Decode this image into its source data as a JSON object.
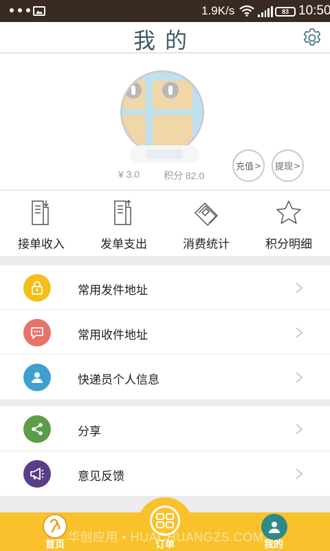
{
  "status_bar": {
    "net_speed": "1.9K/s",
    "battery": "83",
    "time": "10:50"
  },
  "header": {
    "title": "我的",
    "settings_icon": "gear-icon"
  },
  "profile": {
    "balance": "¥ 3.0",
    "points": "积分 82.0",
    "recharge_label": "充值",
    "withdraw_label": "提现"
  },
  "quick_actions": [
    {
      "label": "接单收入",
      "icon": "receive-order-doc-icon"
    },
    {
      "label": "发单支出",
      "icon": "send-order-doc-icon"
    },
    {
      "label": "消费统计",
      "icon": "ticket-stats-icon"
    },
    {
      "label": "积分明细",
      "icon": "star-icon"
    }
  ],
  "menu_group_1": [
    {
      "label": "常用发件地址",
      "icon": "lock-icon",
      "color": "#f5bf1a"
    },
    {
      "label": "常用收件地址",
      "icon": "chat-bubble-icon",
      "color": "#e7726a"
    },
    {
      "label": "快递员个人信息",
      "icon": "person-icon",
      "color": "#3fa0cf"
    }
  ],
  "menu_group_2": [
    {
      "label": "分享",
      "icon": "share-icon",
      "color": "#5c9d4a"
    },
    {
      "label": "意见反馈",
      "icon": "megaphone-icon",
      "color": "#5b3d86"
    }
  ],
  "bottom_nav": {
    "home_label": "首页",
    "order_label": "订单",
    "me_label": "我的",
    "accent_color": "#f9c22c"
  },
  "watermark": "华创应用 • HUACHUANGZS.COM"
}
